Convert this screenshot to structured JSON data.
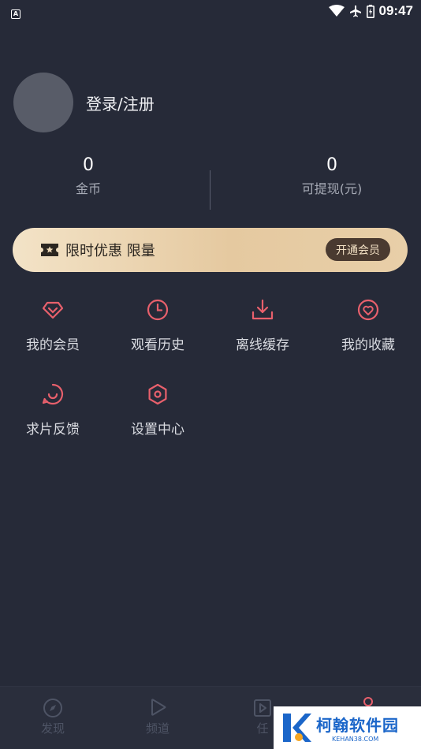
{
  "status_bar": {
    "time": "09:47",
    "left_icon": "a-notification-icon",
    "right_icons": [
      "wifi-icon",
      "airplane-icon",
      "battery-icon"
    ]
  },
  "profile": {
    "login_label": "登录/注册"
  },
  "stats": {
    "coins": {
      "value": "0",
      "label": "金币"
    },
    "cash": {
      "value": "0",
      "label": "可提现(元)"
    }
  },
  "vip_banner": {
    "text": "限时优惠 限量",
    "button_label": "开通会员",
    "icon": "ticket-star-icon"
  },
  "menu": [
    {
      "label": "我的会员",
      "icon": "diamond-icon"
    },
    {
      "label": "观看历史",
      "icon": "clock-icon"
    },
    {
      "label": "离线缓存",
      "icon": "download-icon"
    },
    {
      "label": "我的收藏",
      "icon": "heart-icon"
    },
    {
      "label": "求片反馈",
      "icon": "feedback-icon"
    },
    {
      "label": "设置中心",
      "icon": "settings-icon"
    }
  ],
  "tabbar": [
    {
      "label": "发现",
      "icon": "compass-icon"
    },
    {
      "label": "频道",
      "icon": "play-icon"
    },
    {
      "label": "任",
      "icon": "task-icon"
    },
    {
      "label": "",
      "icon": "profile-icon"
    }
  ],
  "watermark": {
    "title": "柯翰软件园",
    "subtitle": "KEHAN38.COM"
  },
  "colors": {
    "background": "#262a38",
    "accent": "#e8606c",
    "vip_gold_start": "#f3e3c7",
    "vip_gold_end": "#e5c9a0",
    "vip_button": "#4a3a30"
  }
}
